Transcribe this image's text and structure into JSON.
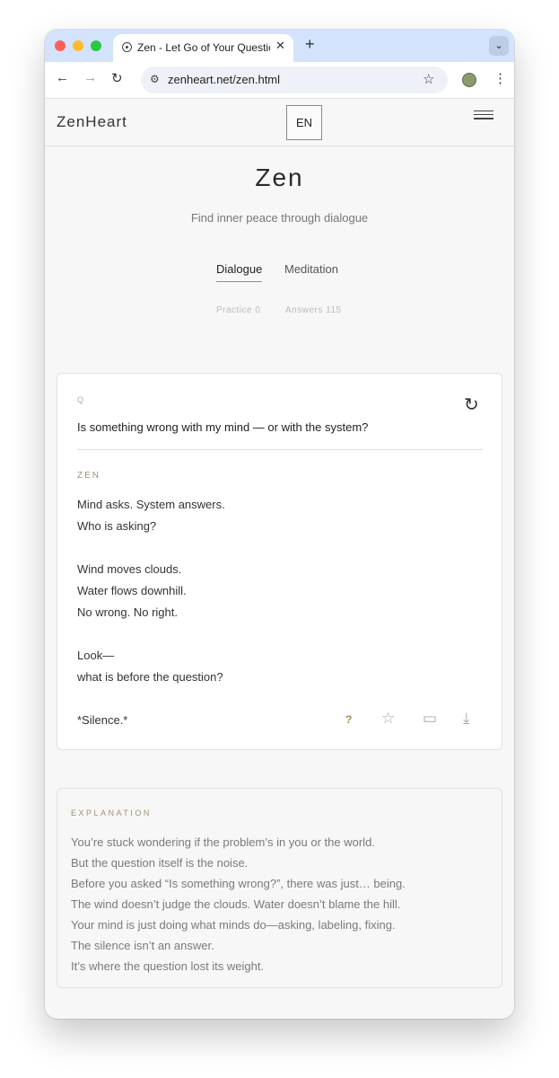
{
  "browser": {
    "tab_title": "Zen - Let Go of Your Questions",
    "tab_close": "✕",
    "new_tab": "+",
    "tab_menu": "⌄",
    "url": "zenheart.net/zen.html",
    "back": "←",
    "forward": "→",
    "reload": "↻",
    "star": "☆",
    "menu": "⋮",
    "site_info": "⚙"
  },
  "header": {
    "logo": "ZenHeart",
    "lang": "EN"
  },
  "hero": {
    "title": "Zen",
    "subtitle": "Find inner peace through dialogue"
  },
  "tabs": [
    {
      "label": "Dialogue",
      "active": true
    },
    {
      "label": "Meditation",
      "active": false
    }
  ],
  "stats": {
    "practice_label": "Practice",
    "practice_value": "0",
    "answers_label": "Answers",
    "answers_value": "115"
  },
  "card": {
    "q_label": "Q",
    "question": "Is something wrong with my mind — or with the system?",
    "zen_label": "ZEN",
    "answer_lines": [
      "Mind asks. System answers.",
      "Who is asking?",
      "Wind moves clouds.",
      "Water flows downhill.",
      "No wrong. No right.",
      "Look—",
      "what is before the question?"
    ],
    "closing": "*Silence.*",
    "actions": {
      "question_mark": "?",
      "star": "☆",
      "comment": "▭",
      "download": "⤓"
    },
    "refresh": "↻"
  },
  "explanation": {
    "label": "EXPLANATION",
    "lines": [
      "You’re stuck wondering if the problem’s in you or the world.",
      "But the question itself is the noise.",
      "Before you asked “Is something wrong?”, there was just… being.",
      "The wind doesn’t judge the clouds. Water doesn’t blame the hill.",
      "Your mind is just doing what minds do—asking, labeling, fixing.",
      "The silence isn’t an answer.",
      "It’s where the question lost its weight."
    ]
  },
  "colors": {
    "accent": "#a08c6e",
    "tabbar": "#d3e3fd",
    "page_bg": "#f7f7f7"
  }
}
